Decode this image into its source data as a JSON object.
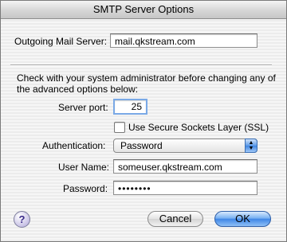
{
  "window": {
    "title": "SMTP Server Options"
  },
  "outgoing": {
    "label": "Outgoing Mail Server:",
    "value": "mail.qkstream.com"
  },
  "advanced": {
    "note_line1": "Check with your system administrator before changing any of",
    "note_line2": "the advanced options below:",
    "port_label": "Server port:",
    "port_value": "25",
    "ssl_label": "Use Secure Sockets Layer (SSL)",
    "ssl_checked": false,
    "auth_label": "Authentication:",
    "auth_value": "Password",
    "username_label": "User Name:",
    "username_value": "someuser.qkstream.com",
    "password_label": "Password:",
    "password_value": "••••••••"
  },
  "buttons": {
    "help": "?",
    "cancel": "Cancel",
    "ok": "OK"
  },
  "icons": {
    "popup_arrows": "up-down-arrows-icon",
    "help": "help-icon"
  }
}
